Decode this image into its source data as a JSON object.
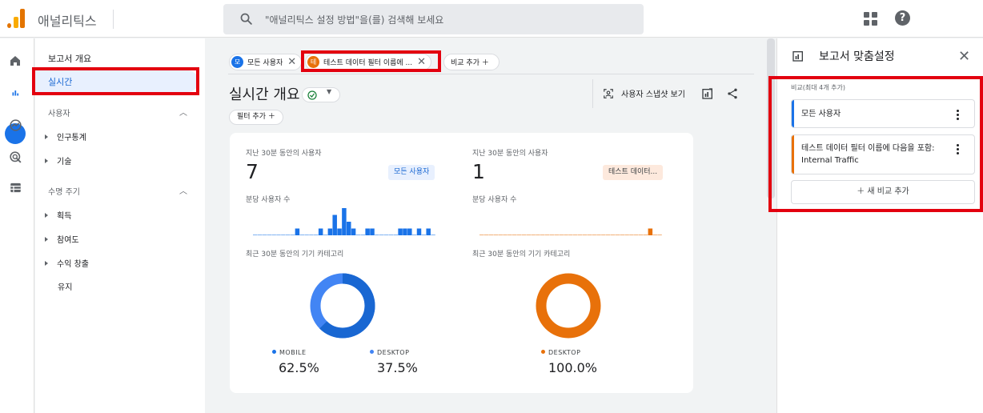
{
  "header": {
    "app_title": "애널리틱스",
    "search_placeholder": "\"애널리틱스 설정 방법\"을(를) 검색해 보세요",
    "icons": [
      "analytics-logo-icon",
      "search-icon",
      "apps-grid-icon",
      "help-icon"
    ],
    "help_glyph": "?"
  },
  "rail": {
    "icons": [
      "home-icon",
      "reports-icon",
      "explore-icon",
      "advertising-icon",
      "configure-icon"
    ]
  },
  "nav": {
    "overview": "보고서 개요",
    "realtime": "실시간",
    "users_section": "사용자",
    "users_items": [
      "인구통계",
      "기술"
    ],
    "lifecycle_section": "수명 주기",
    "lifecycle_items": [
      "획득",
      "참여도",
      "수익 창출"
    ],
    "retention": "유지"
  },
  "main": {
    "chips": {
      "all_users_badge": "모",
      "all_users": "모든 사용자",
      "test_badge": "테",
      "test": "테스트 데이터 필터 이름에 ...",
      "close": "✕",
      "add_compare": "비교 추가 ＋"
    },
    "page_title": "실시간 개요",
    "filter_add": "필터 추가 ＋",
    "snapshot": "사용자 스냅샷 보기",
    "left": {
      "users_caption": "지난 30분 동안의 사용자",
      "users_value": "7",
      "badge": "모든 사용자",
      "per_minute_caption": "분당 사용자 수",
      "device_caption": "최근 30분 동안의 기기 카테고리",
      "legend": [
        {
          "label": "MOBILE",
          "value": "62.5%",
          "color": "#1a73e8"
        },
        {
          "label": "DESKTOP",
          "value": "37.5%",
          "color": "#4285f4"
        }
      ]
    },
    "right": {
      "users_caption": "지난 30분 동안의 사용자",
      "users_value": "1",
      "badge": "테스트 데이터...",
      "per_minute_caption": "분당 사용자 수",
      "device_caption": "최근 30분 동안의 기기 카테고리",
      "legend": [
        {
          "label": "DESKTOP",
          "value": "100.0%",
          "color": "#e8710a"
        }
      ]
    },
    "bars_left": [
      0,
      0,
      0,
      0,
      0,
      0,
      0,
      0,
      0,
      1,
      0,
      0,
      0,
      0,
      1,
      0,
      1,
      3,
      1,
      4,
      2,
      1,
      0,
      0,
      1,
      1,
      0,
      0,
      0,
      0,
      0,
      1,
      1,
      1,
      0,
      1,
      0,
      1,
      0
    ],
    "bars_right": [
      0,
      0,
      0,
      0,
      0,
      0,
      0,
      0,
      0,
      0,
      0,
      0,
      0,
      0,
      0,
      0,
      0,
      0,
      0,
      0,
      0,
      0,
      0,
      0,
      0,
      0,
      0,
      0,
      0,
      0,
      0,
      0,
      0,
      0,
      0,
      0,
      1,
      0,
      0
    ]
  },
  "panel": {
    "title": "보고서 맞춤설정",
    "close": "✕",
    "compare_label": "비교(최대 4개 추가)",
    "comparisons": [
      {
        "text": "모든 사용자",
        "color": "#1a73e8"
      },
      {
        "text": "테스트 데이터 필터 이름에 다음을 포함: Internal Traffic",
        "color": "#e8710a"
      }
    ],
    "add_new": "＋ 새 비교 추가"
  },
  "colors": {
    "accent": "#1a73e8",
    "orange": "#e8710a",
    "highlight": "#e3000f"
  }
}
